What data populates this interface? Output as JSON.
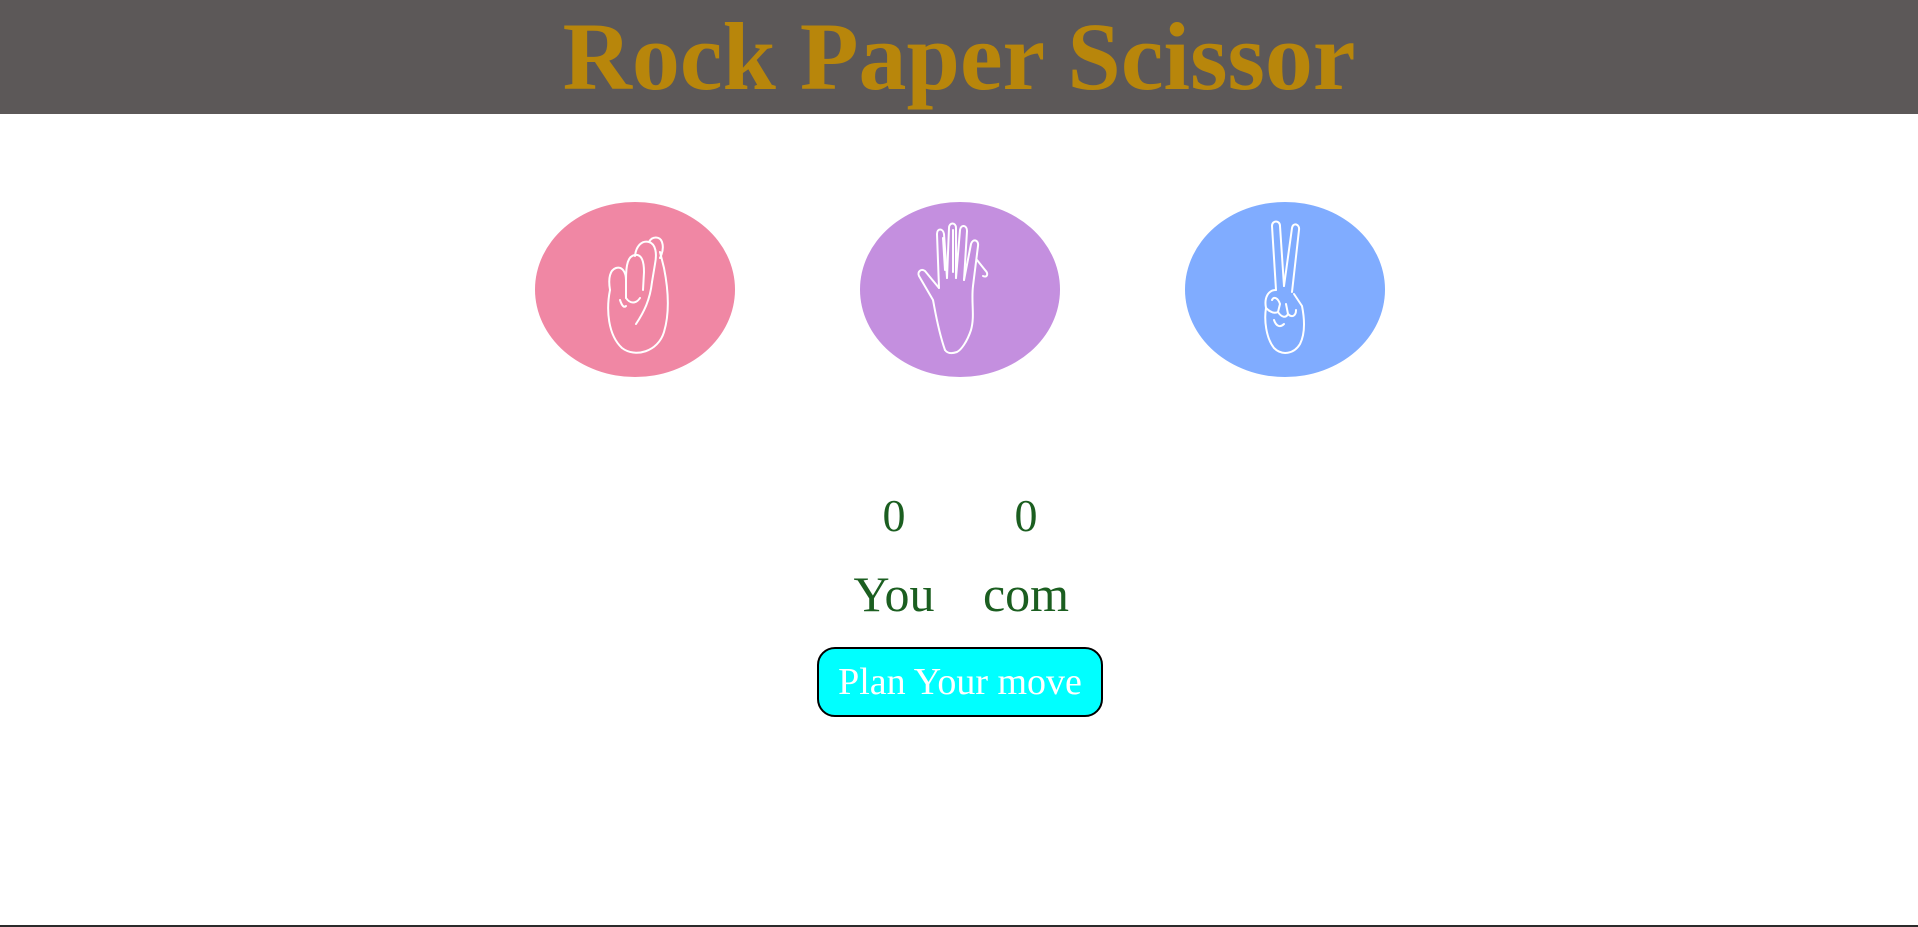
{
  "header": {
    "title": "Rock Paper Scissor",
    "background": "#5c5858",
    "title_color": "#b8860b"
  },
  "choices": [
    {
      "id": "rock",
      "icon": "fist-icon",
      "color": "#f087a4"
    },
    {
      "id": "paper",
      "icon": "open-hand-icon",
      "color": "#c48fdf"
    },
    {
      "id": "scissors",
      "icon": "peace-hand-icon",
      "color": "#80acff"
    }
  ],
  "scoreboard": {
    "user_score": "0",
    "user_label": "You",
    "comp_score": "0",
    "comp_label": "com",
    "text_color": "#1b5e20"
  },
  "message": {
    "text": "Plan Your move",
    "background": "#00ffff"
  }
}
